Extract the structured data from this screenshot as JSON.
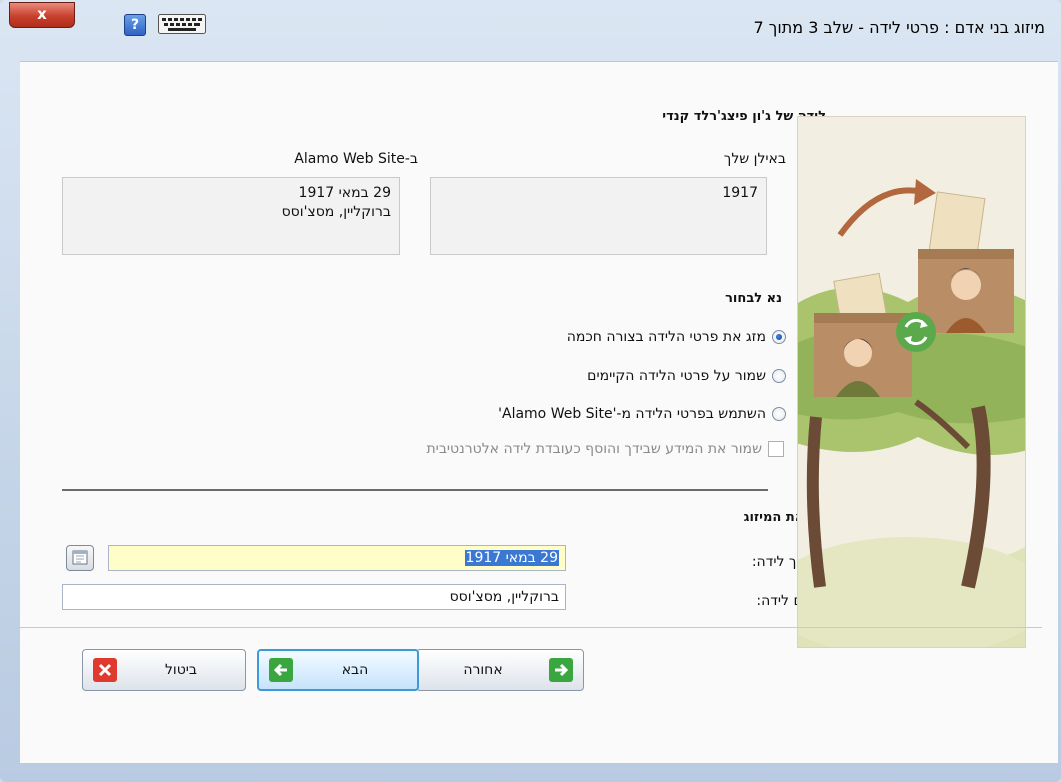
{
  "window": {
    "title": "מיזוג בני אדם : פרטי לידה -  שלב 3 מתוך 7",
    "close_glyph": "x",
    "help_glyph": "?"
  },
  "header": {
    "event_title": "לידה של ג'ון פיצג'רלד קנדי"
  },
  "sources": {
    "left": {
      "label": "ב-Alamo Web Site",
      "date": "29 במאי 1917",
      "place": "ברוקליין, מסצ'וסס"
    },
    "right": {
      "label": "באילן שלך",
      "date": "1917"
    }
  },
  "choose": {
    "heading": "נא לבחור",
    "options": [
      {
        "label": "מזג את פרטי הלידה בצורה חכמה",
        "selected": true
      },
      {
        "label": "שמור על פרטי הלידה הקיימים",
        "selected": false
      },
      {
        "label": "השתמש בפרטי הלידה מ-'Alamo Web Site'",
        "selected": false
      }
    ],
    "alt_checkbox": {
      "label": "שמור את המידע שבידך והוסף כעובדת לידה אלטרנטיבית",
      "checked": false,
      "enabled": false
    }
  },
  "result": {
    "heading": "תוצאת המיזוג",
    "birth_date_label": "תאריך לידה:",
    "birth_date_value": "29 במאי 1917",
    "birth_place_label": "מקום לידה:",
    "birth_place_value": "ברוקליין, מסצ'וסס"
  },
  "buttons": {
    "back": "אחורה",
    "next": "הבא",
    "cancel": "ביטול"
  },
  "colors": {
    "accent_green": "#3aa640",
    "cancel_red": "#e03a2f",
    "highlight_field": "#fffec8",
    "selection": "#3a78d4"
  },
  "icons": {
    "back": "arrow-right-icon",
    "next": "arrow-left-icon",
    "cancel": "x-icon",
    "calendar": "calendar-icon",
    "keyboard": "keyboard-icon",
    "help": "help-icon",
    "merge": "sync-icon"
  }
}
